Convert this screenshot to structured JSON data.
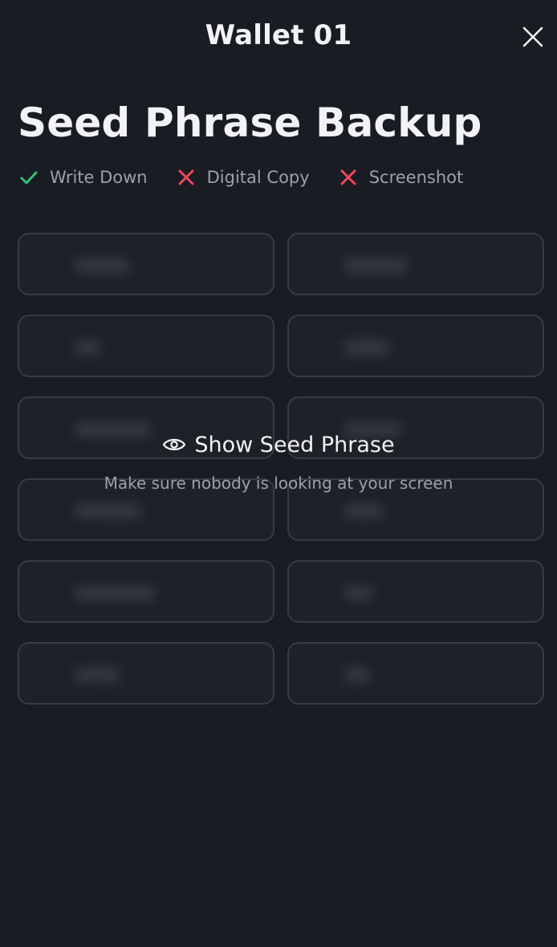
{
  "header": {
    "title": "Wallet 01",
    "close_icon": "close-icon"
  },
  "page": {
    "title": "Seed Phrase Backup"
  },
  "rules": [
    {
      "label": "Write Down",
      "icon": "check-icon",
      "allowed": true,
      "color": "#2fbf71"
    },
    {
      "label": "Digital Copy",
      "icon": "cross-icon",
      "allowed": false,
      "color": "#f0475c"
    },
    {
      "label": "Screenshot",
      "icon": "cross-icon",
      "allowed": false,
      "color": "#f0475c"
    }
  ],
  "seed_words": {
    "count": 12,
    "state": "hidden"
  },
  "reveal": {
    "button_label": "Show Seed Phrase",
    "icon": "eye-icon",
    "hint": "Make sure nobody is looking at your screen"
  },
  "colors": {
    "background": "#1a1c23",
    "box_border": "#383b44",
    "text_primary": "#f2f3f5",
    "text_secondary": "#9ca0aa"
  }
}
